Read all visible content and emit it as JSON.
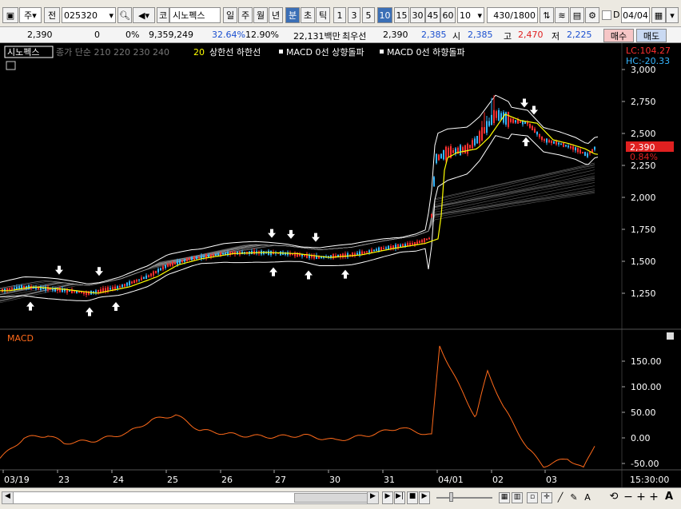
{
  "toolbar": {
    "mode_label": "주",
    "prev_label": "전",
    "code": "025320",
    "market_label": "코",
    "stock_name": "시노펙스",
    "period_tabs": [
      "일",
      "주",
      "월",
      "년",
      "분",
      "초",
      "틱"
    ],
    "minute_options": [
      "1",
      "3",
      "5",
      "10",
      "15",
      "30",
      "45",
      "60"
    ],
    "active_minute": "10",
    "count_value": "10",
    "range_value": "430/1800",
    "date_value": "04/04"
  },
  "infobar": {
    "price": "2,390",
    "change": "0",
    "change_pct": "0%",
    "volume": "9,359,249",
    "turnover_pct": "32.64%",
    "ratio_pct": "12.90%",
    "amount": "22,131백만",
    "bid_label": "최우선",
    "bid": "2,390",
    "ask": "2,385",
    "open_label": "시",
    "open": "2,385",
    "high_label": "고",
    "high": "2,470",
    "low_label": "저",
    "low": "2,225",
    "buy_label": "매수",
    "sell_label": "매도"
  },
  "legend": {
    "name": "시노펙스",
    "ma_text": "종가 단순 210 220 230 240",
    "ma20": "20",
    "upper_lower": "상한선 하한선",
    "macd_up": "MACD 0선 상향돌파",
    "macd_down": "MACD 0선 하향돌파"
  },
  "price_axis": {
    "labels": [
      "3,000",
      "2,750",
      "2,500",
      "2,250",
      "2,000",
      "1,750",
      "1,500",
      "1,250"
    ],
    "lc": "LC:104.27",
    "hc": "HC:-20.33",
    "current": "2,390",
    "current_pct": "0.84%"
  },
  "macd": {
    "title": "MACD",
    "labels": [
      "150.00",
      "100.00",
      "50.00",
      "0.00",
      "-50.00"
    ]
  },
  "date_axis": {
    "labels": [
      "03/19",
      "23",
      "24",
      "25",
      "26",
      "27",
      "30",
      "31",
      "04/01",
      "02",
      "03"
    ],
    "time": "15:30:00"
  },
  "colors": {
    "up": "#ff3030",
    "down": "#35b6ff",
    "ma20": "#ffff00",
    "macd": "#ff6a1a",
    "accent": "#3b6fb6"
  }
}
